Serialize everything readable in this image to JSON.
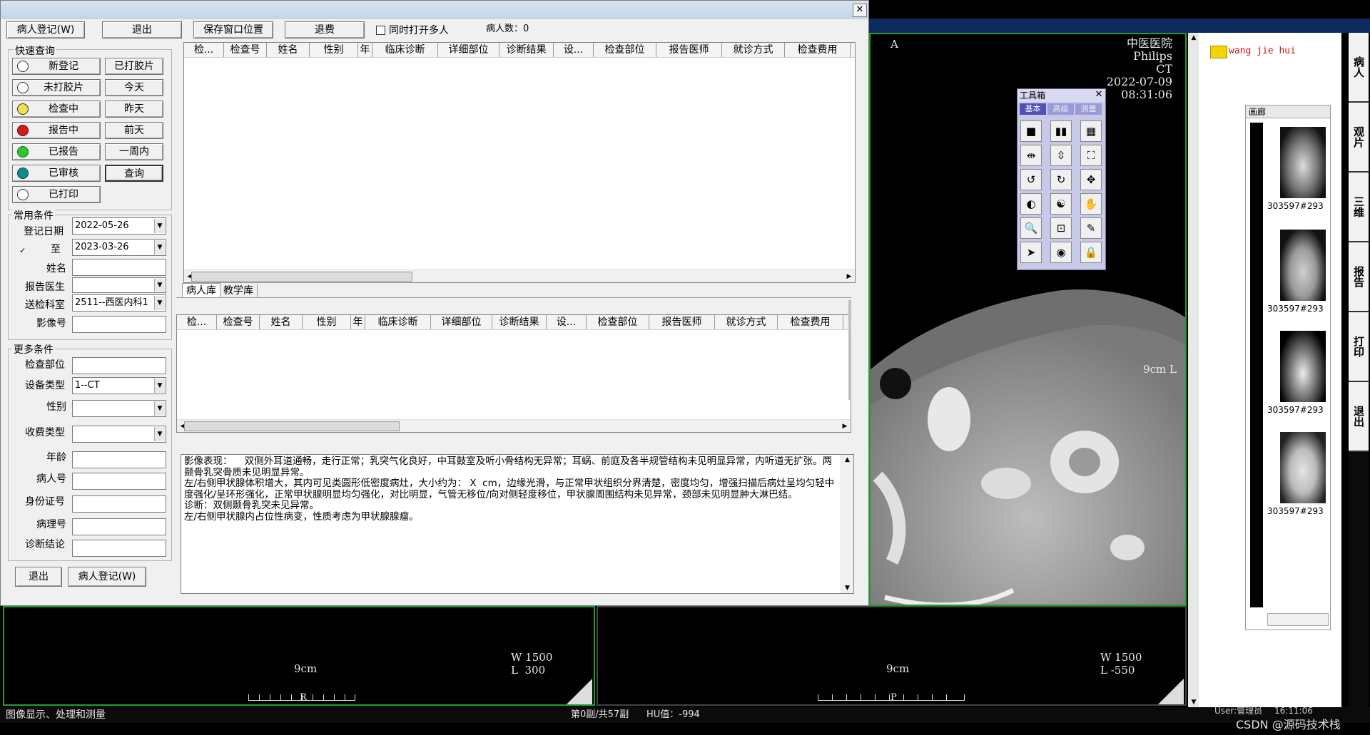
{
  "viewer": {
    "hospital": "中医医院",
    "manufacturer": "Philips",
    "modality": "CT",
    "date": "2022-07-09",
    "time": "08:31:06",
    "orient_a": "A",
    "left_pane": {
      "scale": "9cm",
      "w": "W 1500",
      "l": "L  300",
      "ruler_mark": "R"
    },
    "right_pane": {
      "scale": "9cm",
      "w": "W 1500",
      "l": "L -550",
      "ruler_mark": "P",
      "side_scale": "9cm L"
    }
  },
  "right_panel": {
    "user_name": "wang jie hui",
    "gallery_title": "画廊",
    "thumbs": [
      "303597#293",
      "303597#293",
      "303597#293",
      "303597#293"
    ],
    "side_tabs": [
      "病人",
      "观片",
      "三维",
      "报告",
      "打印",
      "退出"
    ]
  },
  "toolbox": {
    "title": "工具箱",
    "tabs": [
      "基本",
      "高级",
      "测量"
    ],
    "active_tab": "基本"
  },
  "dialog": {
    "buttons_top": {
      "register": "病人登记(W)",
      "exit": "退出",
      "save_pos": "保存窗口位置",
      "refund": "退费"
    },
    "open_multi": "同时打开多人",
    "patient_count": "病人数：0",
    "quick_query": {
      "title": "快速查询",
      "status_items": [
        "新登记",
        "未打胶片",
        "检查中",
        "报告中",
        "已报告",
        "已审核",
        "已打印"
      ],
      "status_colors": [
        "#ffffff",
        "#ffffff",
        "#f2e24a",
        "#d21a1a",
        "#31c431",
        "#128a8a",
        "#ffffff"
      ],
      "date_items": [
        "已打胶片",
        "今天",
        "昨天",
        "前天",
        "一周内",
        "查询"
      ]
    },
    "common": {
      "title": "常用条件",
      "reg_date_label": "登记日期",
      "reg_date": "2022-05-26",
      "to_label": "至",
      "to_date": "2023-03-26",
      "name_label": "姓名",
      "doctor_label": "报告医生",
      "dept_label": "送检科室",
      "dept_value": "2511--西医内科1",
      "image_no_label": "影像号"
    },
    "more": {
      "title": "更多条件",
      "exam_part": "检查部位",
      "device_type": "设备类型",
      "device_value": "1--CT",
      "gender": "性别",
      "charge_type": "收费类型",
      "age": "年龄",
      "patient_no": "病人号",
      "id_no": "身份证号",
      "pathology_no": "病理号",
      "diag_conclusion": "诊断结论"
    },
    "bottom_buttons": {
      "exit": "退出",
      "register": "病人登记(W)"
    },
    "columns": [
      "检...",
      "检查号",
      "姓名",
      "性别",
      "年",
      "临床诊断",
      "详细部位",
      "诊断结果",
      "设...",
      "检查部位",
      "报告医师",
      "就诊方式",
      "检查费用"
    ],
    "tabs": [
      "病人库",
      "教学库"
    ],
    "report_text": "影像表现：    双侧外耳道通畅，走行正常；乳突气化良好，中耳鼓室及听小骨结构无异常；耳蜗、前庭及各半规管结构未见明显异常，内听道无扩张。两颞骨乳突骨质未见明显异常。\n左/右侧甲状腺体积增大，其内可见类圆形低密度病灶，大小约为： X  cm，边缘光滑，与正常甲状组织分界清楚，密度均匀，增强扫描后病灶呈均匀轻中度强化/呈环形强化，正常甲状腺明显均匀强化，对比明显，气管无移位/向对侧轻度移位，甲状腺周围结构未见异常，颈部未见明显肿大淋巴结。\n诊断：双侧颞骨乳突未见异常。\n左/右侧甲状腺内占位性病变，性质考虑为甲状腺腺瘤。"
  },
  "status_bar": {
    "left": "图像显示、处理和测量",
    "frame": "第0副/共57副",
    "hu": "HU值：-994",
    "user": "User:管理员",
    "time": "16:11:06",
    "watermark": "CSDN @源码技术栈"
  }
}
